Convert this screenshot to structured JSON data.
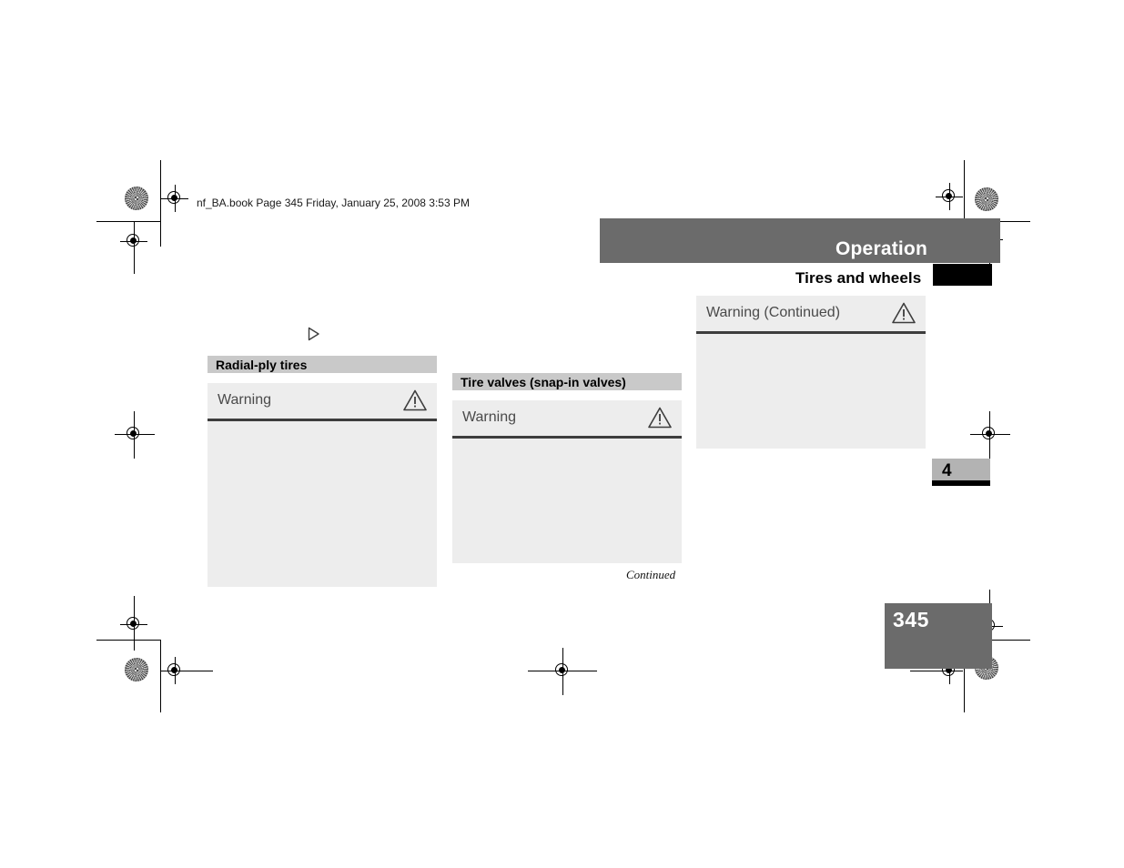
{
  "document": {
    "file_info": "nf_BA.book  Page 345  Friday, January 25, 2008  3:53 PM",
    "page_number": "345",
    "chapter_tab": "4"
  },
  "header": {
    "title": "Operation",
    "subtitle": "Tires and wheels"
  },
  "columns": {
    "left": {
      "continuation_marker": "continuation-arrow",
      "section_heading": "Radial-ply tires",
      "warning": {
        "title": "Warning",
        "icon": "warning-triangle-icon",
        "body": ""
      }
    },
    "middle": {
      "section_heading": "Tire valves (snap-in valves)",
      "warning": {
        "title": "Warning",
        "icon": "warning-triangle-icon",
        "body": ""
      },
      "continued_note": "Continued"
    },
    "right": {
      "warning": {
        "title": "Warning (Continued)",
        "icon": "warning-triangle-icon",
        "body": ""
      }
    }
  },
  "colors": {
    "header_bar": "#6b6b6b",
    "section_heading_bg": "#c9c9c9",
    "warning_box_bg": "#ededed",
    "warning_rule": "#3d3d3d",
    "chapter_tab_bg": "#b3b3b3",
    "folio_bg": "#6b6b6b",
    "black_tab": "#000000"
  }
}
